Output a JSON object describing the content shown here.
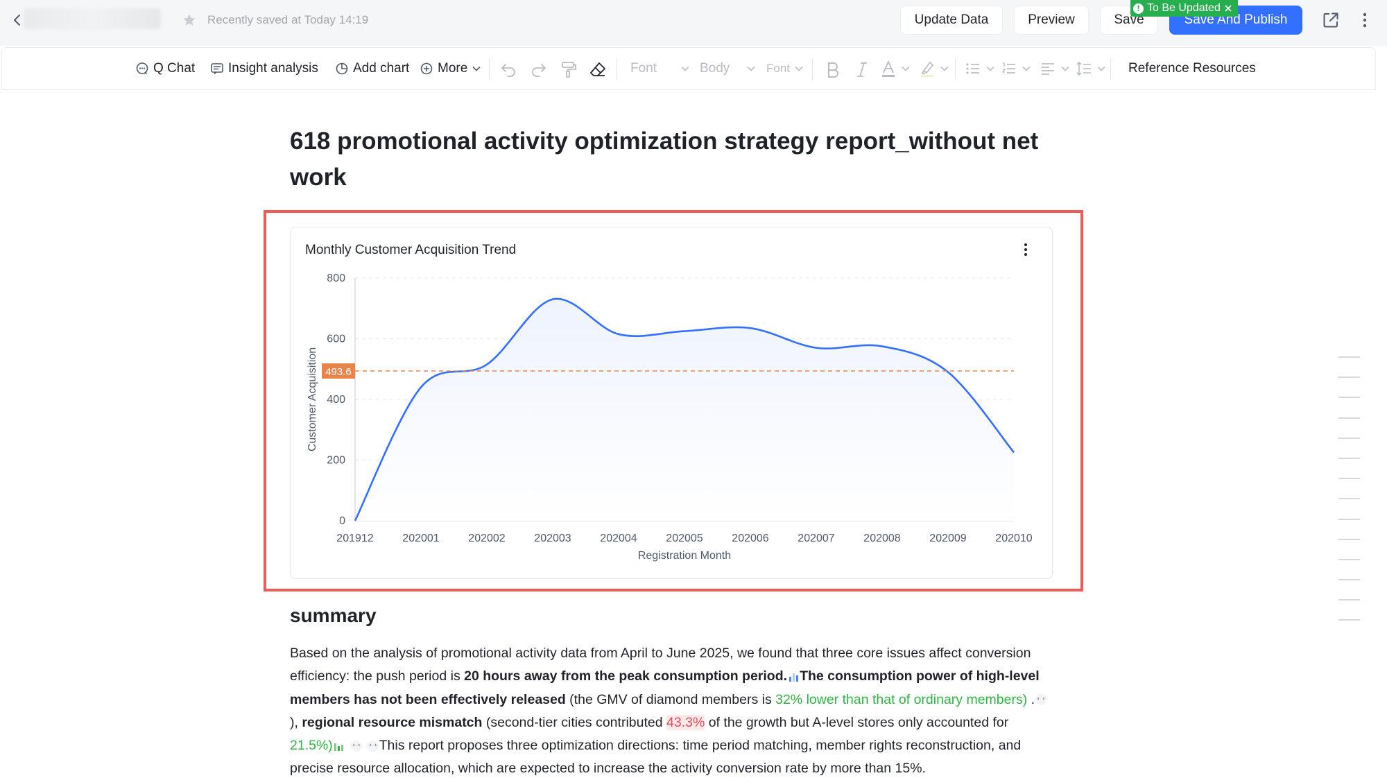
{
  "header": {
    "saved_text": "Recently saved at Today 14:19",
    "update_data": "Update Data",
    "preview": "Preview",
    "save": "Save",
    "save_publish": "Save And Publish",
    "badge": "To Be Updated"
  },
  "toolbar": {
    "q_chat": "Q Chat",
    "insight": "Insight analysis",
    "add_chart": "Add chart",
    "more": "More",
    "font1": "Font",
    "body": "Body",
    "font2": "Font",
    "reference": "Reference Resources"
  },
  "doc": {
    "title": "618 promotional activity optimization strategy report_without net work",
    "summary_heading": "summary"
  },
  "summary": {
    "s1": "Based on the analysis of promotional activity data from April to June 2025, we found that three core issues affect conversion efficiency: the push period is ",
    "b1": "20 hours away from the peak consumption period.",
    "b2": "The consumption power of high-level members has not been effectively released",
    "s2": " (the GMV of diamond members is ",
    "g1": "32% lower than that of ordinary members)",
    "s3": " .",
    "s4": "), ",
    "b3": "regional resource mismatch",
    "s5": " (second-tier cities contributed ",
    "r1": "43.3%",
    "s6": " of the growth but A-level stores only accounted for ",
    "g2": "21.5%)",
    "s7": "This report proposes three optimization directions: time period matching, member rights reconstruction, and precise resource allocation, which are expected to increase the activity conversion rate by more than 15%."
  },
  "chart_data": {
    "type": "area",
    "title": "Monthly Customer Acquisition Trend",
    "xlabel": "Registration Month",
    "ylabel": "Customer Acquisition",
    "x": [
      "201912",
      "202001",
      "202002",
      "202003",
      "202004",
      "202005",
      "202006",
      "202007",
      "202008",
      "202009",
      "202010"
    ],
    "values": [
      0,
      440,
      515,
      730,
      615,
      625,
      635,
      570,
      575,
      490,
      225
    ],
    "yticks": [
      0,
      200,
      400,
      600,
      800
    ],
    "ylim": [
      0,
      800
    ],
    "reference_line": {
      "value": 493.6,
      "label": "493.6",
      "style": "dashed"
    },
    "grid": true,
    "colors": {
      "line": "#3370ff",
      "area": "#eef3fe",
      "reference": "#e8834a"
    }
  }
}
